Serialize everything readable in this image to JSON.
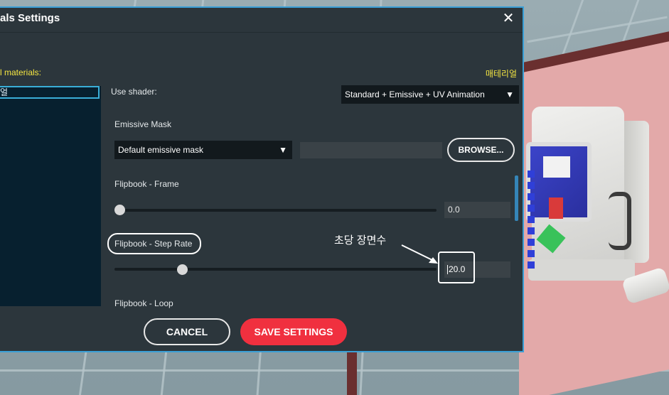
{
  "dialog": {
    "title": "als Settings",
    "close_symbol": "✕"
  },
  "materials": {
    "label": "l materials:",
    "korean_tag": "매테리얼",
    "items": [
      "얼"
    ]
  },
  "shader": {
    "label": "Use shader:",
    "selected": "Standard + Emissive + UV Animation"
  },
  "emissive_mask": {
    "label": "Emissive Mask",
    "selected": "Default emissive mask",
    "path_value": "",
    "browse_label": "BROWSE..."
  },
  "flipbook_frame": {
    "label": "Flipbook - Frame",
    "value": "0.0",
    "slider_fraction": 0.0
  },
  "flipbook_step_rate": {
    "label": "Flipbook - Step Rate",
    "value": "20.0",
    "slider_fraction": 0.2
  },
  "flipbook_loop": {
    "label": "Flipbook - Loop"
  },
  "annotation": {
    "text": "초당 장면수"
  },
  "footer": {
    "cancel_label": "CANCEL",
    "save_label": "SAVE SETTINGS"
  },
  "colors": {
    "accent_border": "#3a9fd6",
    "save_button": "#f0303f",
    "materials_label": "#f5e642"
  },
  "icons": {
    "close": "close-icon",
    "dropdown": "triangle-down-icon"
  }
}
